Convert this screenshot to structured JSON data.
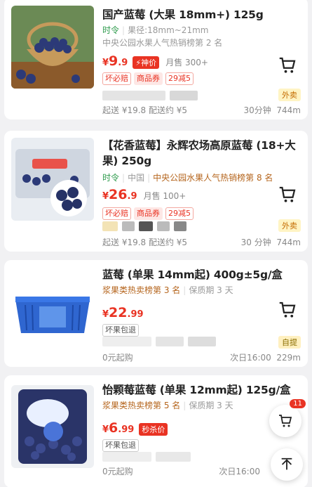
{
  "products": [
    {
      "title": "国产蓝莓 (大果 18mm+) 125g",
      "tag_season": "时令",
      "spec": "果径:18mm~21mm",
      "rank_text": "中央公园水果人气热销榜第 2 名",
      "price_int": "9",
      "price_dec": ".9",
      "special_label": "神价",
      "sales": "月售 300+",
      "tags": [
        "坏必赔",
        "商品券",
        "29减5"
      ],
      "bottom_left": "起送 ¥19.8  配送约 ¥5",
      "time": "30分钟",
      "distance": "744m",
      "badge": "外卖"
    },
    {
      "title": "【花香蓝莓】永辉农场高原蓝莓 (18+大果) 250g",
      "tag_season": "时令",
      "origin": "中国",
      "rank_text": "中央公园水果人气热销榜第 8 名",
      "price_int": "26",
      "price_dec": ".9",
      "sales": "月售 100+",
      "tags": [
        "坏必赔",
        "商品券",
        "29减5"
      ],
      "bottom_left": "起送 ¥19.8  配送约 ¥5",
      "time": "30 分钟",
      "distance": "744m",
      "badge": "外卖"
    },
    {
      "title": "蓝莓 (单果 14mm起) 400g±5g/盒",
      "rank_text": "浆果类热卖榜第 3 名",
      "shelf": "保质期 3 天",
      "price_int": "22",
      "price_dec": ".99",
      "tags": [
        "坏果包退"
      ],
      "bottom_left": "0元起购",
      "time": "次日16:00",
      "distance": "229m",
      "badge": "自提"
    },
    {
      "title": "怡颗莓蓝莓 (单果 12mm起) 125g/盒",
      "rank_text": "浆果类热卖榜第 5 名",
      "shelf": "保质期 3 天",
      "price_int": "6",
      "price_dec": ".99",
      "special_label": "秒杀价",
      "tags": [
        "坏果包退"
      ],
      "bottom_left": "0元起购",
      "time": "次日16:00"
    }
  ],
  "floating": {
    "cart_count": "11"
  },
  "colors": {
    "price": "#e93323",
    "season_green": "#2e9b4c",
    "rank_brown": "#b5651d"
  }
}
